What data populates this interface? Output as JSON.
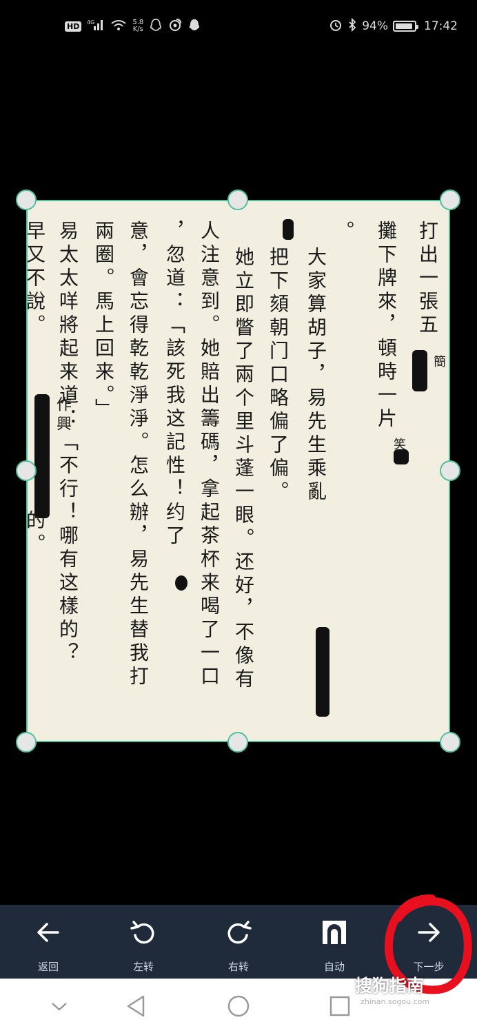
{
  "status_bar": {
    "hd": "HD",
    "network": "4G",
    "speed_value": "5.8",
    "speed_unit": "K/s",
    "battery": "94%",
    "battery_level": 0.94,
    "time": "17:42"
  },
  "document": {
    "columns": [
      "打出一張五",
      "攤下牌來，頓時一片",
      "。",
      "大家算胡子，易先生乘亂",
      "把下頦朝门口略偏了偏。",
      "她立即瞥了兩个里斗蓬一眼。还好，不像有",
      "人注意到。她賠出籌碼，拿起茶杯来喝了一口",
      "，忽道：「該死我这記性！约了",
      "意，會忘得乾乾淨淨。怎么辦，易先生替我打",
      "兩圈。馬上回来。」",
      "易太太咩將起来道：「不行！哪有这樣的？",
      "早又不說。",
      "的。"
    ],
    "annotations": [
      "簡",
      "笑",
      "作興"
    ]
  },
  "toolbar": {
    "back_label": "返回",
    "rotate_left_label": "左转",
    "rotate_right_label": "右转",
    "auto_label": "自动",
    "next_label": "下一步"
  },
  "watermark": {
    "main": "搜狗指南",
    "sub": "zhinan.sogou.com"
  },
  "colors": {
    "crop_frame": "#4fbf9f",
    "toolbar_bg": "#1f2a3b",
    "annotation_red": "#e8101e"
  }
}
